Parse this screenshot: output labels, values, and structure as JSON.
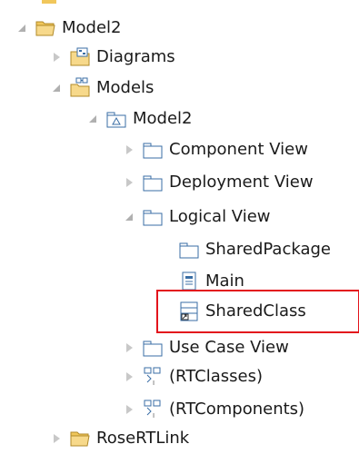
{
  "tree": {
    "items": [
      {
        "label": "Model2",
        "icon": "open-folder-icon",
        "state": "expanded"
      },
      {
        "label": "Diagrams",
        "icon": "diagrams-folder-icon",
        "state": "collapsed"
      },
      {
        "label": "Models",
        "icon": "models-folder-icon",
        "state": "expanded"
      },
      {
        "label": "Model2",
        "icon": "model-package-icon",
        "state": "expanded"
      },
      {
        "label": "Component View",
        "icon": "package-icon",
        "state": "collapsed"
      },
      {
        "label": "Deployment View",
        "icon": "package-icon",
        "state": "collapsed"
      },
      {
        "label": "Logical View",
        "icon": "package-icon",
        "state": "expanded"
      },
      {
        "label": "SharedPackage",
        "icon": "package-icon",
        "state": "none"
      },
      {
        "label": "Main",
        "icon": "diagram-icon",
        "state": "none"
      },
      {
        "label": "SharedClass",
        "icon": "class-icon",
        "state": "none",
        "highlighted": true
      },
      {
        "label": "Use Case View",
        "icon": "package-icon",
        "state": "collapsed"
      },
      {
        "label": "(RTClasses)",
        "icon": "rt-classes-icon",
        "state": "collapsed"
      },
      {
        "label": "(RTComponents)",
        "icon": "rt-components-icon",
        "state": "collapsed"
      },
      {
        "label": "RoseRTLink",
        "icon": "open-folder-icon",
        "state": "collapsed"
      }
    ]
  },
  "colors": {
    "highlight_border": "#e3141c",
    "folder_yellow": "#f1c75b",
    "package_blue": "#3a6ea5"
  }
}
